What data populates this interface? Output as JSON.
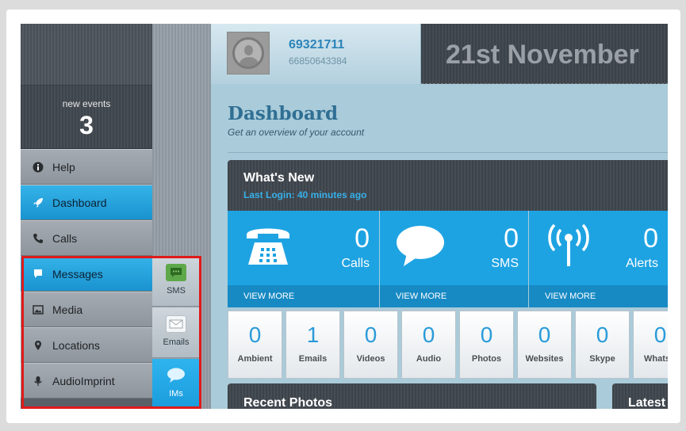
{
  "sidebar": {
    "events_label": "new events",
    "events_count": "3",
    "items": [
      {
        "label": "Help",
        "icon": "info-icon"
      },
      {
        "label": "Dashboard",
        "icon": "rocket-icon"
      },
      {
        "label": "Calls",
        "icon": "phone-icon"
      },
      {
        "label": "Messages",
        "icon": "message-icon"
      },
      {
        "label": "Media",
        "icon": "image-icon"
      },
      {
        "label": "Locations",
        "icon": "location-pin-icon"
      },
      {
        "label": "AudioImprint",
        "icon": "microphone-icon"
      }
    ],
    "subnav": [
      {
        "label": "SMS",
        "icon": "sms-icon"
      },
      {
        "label": "Emails",
        "icon": "email-icon"
      },
      {
        "label": "IMs",
        "icon": "chat-bubble-icon"
      }
    ]
  },
  "profile": {
    "name": "69321711",
    "number": "66850643384"
  },
  "date": "21st November",
  "dashboard": {
    "title": "Dashboard",
    "subtitle": "Get an overview of your account"
  },
  "whats_new": {
    "title": "What's New",
    "last_login": "Last Login: 40 minutes ago"
  },
  "stats": [
    {
      "value": "0",
      "label": "Calls",
      "more": "VIEW MORE",
      "icon": "telephone-icon"
    },
    {
      "value": "0",
      "label": "SMS",
      "more": "VIEW MORE",
      "icon": "speech-bubble-icon"
    },
    {
      "value": "0",
      "label": "Alerts",
      "more": "VIEW MORE",
      "icon": "antenna-icon"
    }
  ],
  "tiles": [
    {
      "value": "0",
      "label": "Ambient"
    },
    {
      "value": "1",
      "label": "Emails"
    },
    {
      "value": "0",
      "label": "Videos"
    },
    {
      "value": "0",
      "label": "Audio"
    },
    {
      "value": "0",
      "label": "Photos"
    },
    {
      "value": "0",
      "label": "Websites"
    },
    {
      "value": "0",
      "label": "Skype"
    },
    {
      "value": "0",
      "label": "WhatsA"
    }
  ],
  "panels": {
    "recent_photos": "Recent Photos",
    "latest": "Latest"
  },
  "colors": {
    "accent": "#1ea3e2",
    "highlight": "#e01a1a"
  }
}
